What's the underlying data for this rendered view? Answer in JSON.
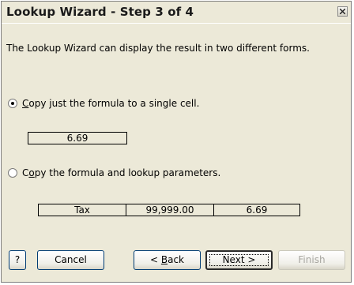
{
  "window": {
    "title": "Lookup Wizard - Step 3 of 4"
  },
  "intro_text": "The Lookup Wizard can display the result in two different forms.",
  "options": [
    {
      "selected": true,
      "label_prefix": "",
      "label_mnemonic": "C",
      "label_rest": "opy just the formula to a single cell."
    },
    {
      "selected": false,
      "label_prefix": "C",
      "label_mnemonic": "o",
      "label_rest": "py the formula and lookup parameters."
    }
  ],
  "single_cell_result": "6.69",
  "parameter_cells": [
    "Tax",
    "99,999.00",
    "6.69"
  ],
  "buttons": {
    "help": "?",
    "cancel": "Cancel",
    "back_prefix": "< ",
    "back_mnemonic": "B",
    "back_rest": "ack",
    "next": "Next >",
    "finish": "Finish"
  },
  "icons": {
    "close": "close-icon",
    "help": "help-icon"
  }
}
